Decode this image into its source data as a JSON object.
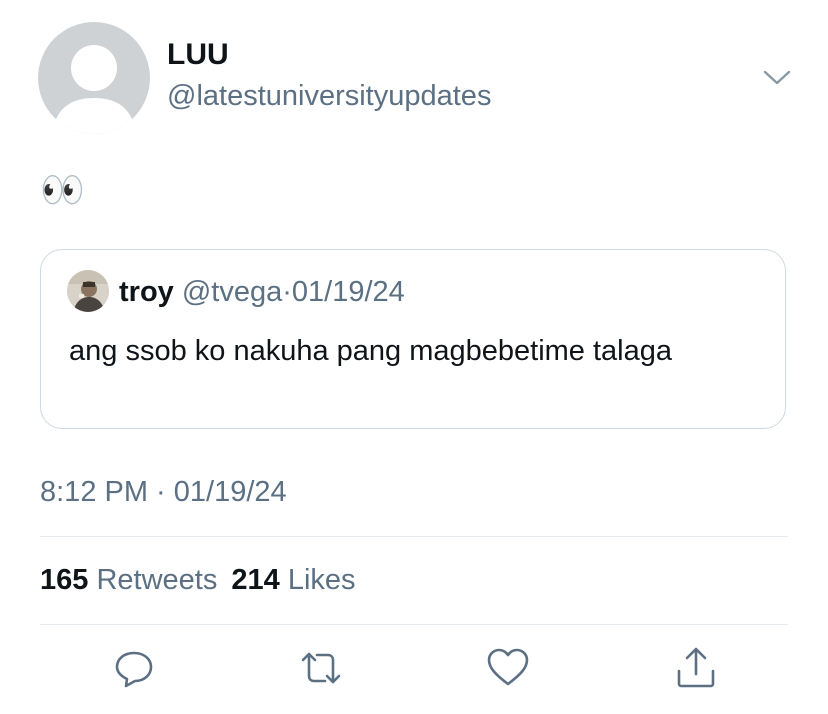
{
  "tweet": {
    "display_name": "LUU",
    "handle": "@latestuniversityupdates",
    "text": "👀",
    "timestamp": "8:12 PM · 01/19/24"
  },
  "quote": {
    "name": "troy",
    "handle": "@tvega",
    "separator": "·",
    "date": "01/19/24",
    "text": "ang ssob ko nakuha pang magbebetime talaga"
  },
  "stats": {
    "retweets_count": "165",
    "retweets_label": "Retweets",
    "likes_count": "214",
    "likes_label": "Likes"
  },
  "icons": {
    "menu": "chevron-down-icon",
    "reply": "reply-icon",
    "retweet": "retweet-icon",
    "like": "heart-icon",
    "share": "share-icon"
  },
  "colors": {
    "secondary_text": "#5b7083",
    "divider": "#e6ecf0",
    "avatar_placeholder": "#cfd2d5"
  }
}
